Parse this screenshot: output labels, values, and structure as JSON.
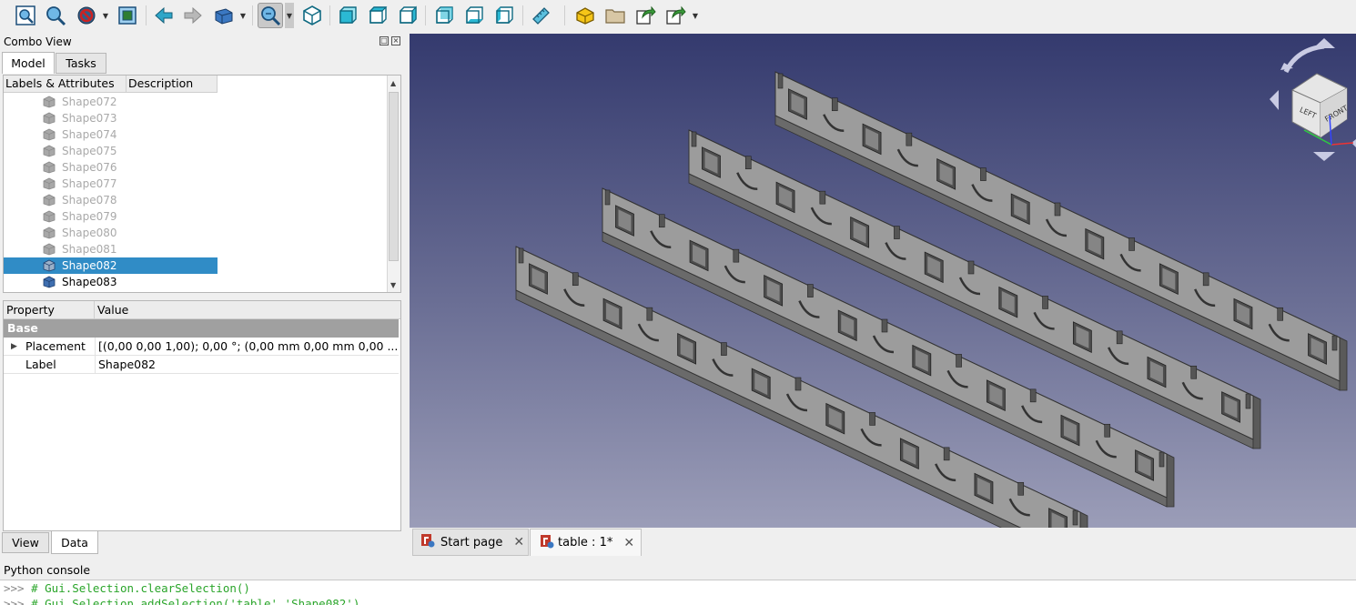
{
  "toolbar": {
    "icons": [
      "fit-all-icon",
      "fit-selection-icon",
      "draw-style-icon",
      "bounding-box-icon",
      "back-icon",
      "forward-icon",
      "sync-view-icon",
      "zoom-icon",
      "isometric-icon",
      "front-view-icon",
      "top-view-icon",
      "right-view-icon",
      "rear-view-icon",
      "bottom-view-icon",
      "left-view-icon",
      "measure-icon",
      "part-icon",
      "folder-icon",
      "link-icon",
      "link-actions-icon"
    ]
  },
  "combo": {
    "title": "Combo View",
    "tabs": [
      "Model",
      "Tasks"
    ],
    "tree_headers": [
      "Labels & Attributes",
      "Description"
    ],
    "items": [
      {
        "label": "Shape072",
        "state": "hidden"
      },
      {
        "label": "Shape073",
        "state": "hidden"
      },
      {
        "label": "Shape074",
        "state": "hidden"
      },
      {
        "label": "Shape075",
        "state": "hidden"
      },
      {
        "label": "Shape076",
        "state": "hidden"
      },
      {
        "label": "Shape077",
        "state": "hidden"
      },
      {
        "label": "Shape078",
        "state": "hidden"
      },
      {
        "label": "Shape079",
        "state": "hidden"
      },
      {
        "label": "Shape080",
        "state": "hidden"
      },
      {
        "label": "Shape081",
        "state": "hidden"
      },
      {
        "label": "Shape082",
        "state": "selected"
      },
      {
        "label": "Shape083",
        "state": "visible"
      }
    ],
    "property_headers": [
      "Property",
      "Value"
    ],
    "group": "Base",
    "properties": [
      {
        "name": "Placement",
        "value": "[(0,00 0,00 1,00); 0,00 °; (0,00 mm  0,00 mm  0,00 ..."
      },
      {
        "name": "Label",
        "value": "Shape082"
      }
    ],
    "bottom_tabs": [
      "View",
      "Data"
    ]
  },
  "viewport": {
    "navcube_faces": [
      "LEFT",
      "FRONT"
    ]
  },
  "doc_tabs": [
    {
      "label": "Start page"
    },
    {
      "label": "table : 1*"
    }
  ],
  "console": {
    "title": "Python console",
    "prompt": ">>> ",
    "lines": [
      "# Gui.Selection.clearSelection()",
      "# Gui.Selection.addSelection('table','Shape082')"
    ]
  },
  "colors": {
    "selection": "#308cc6",
    "console_text": "#2aa52a",
    "viewport_top": "#343a6e",
    "viewport_bottom": "#9b9db8"
  }
}
